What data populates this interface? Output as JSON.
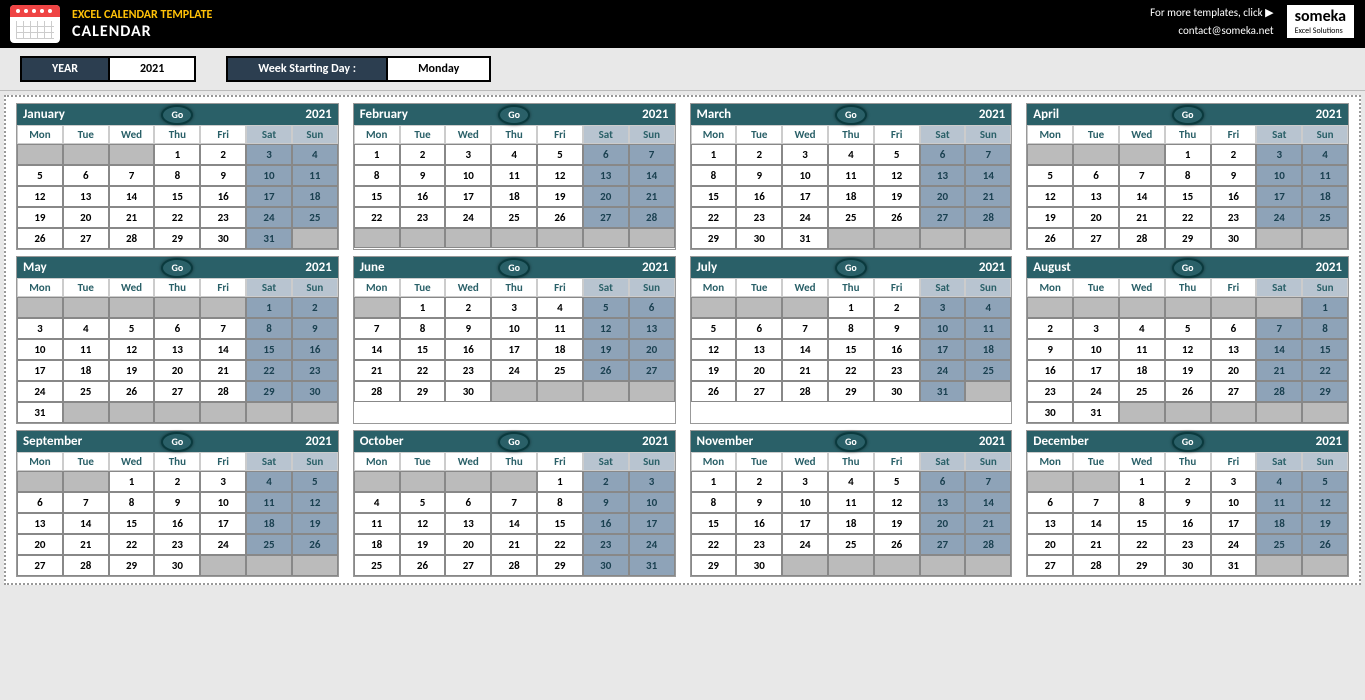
{
  "header": {
    "title_small": "EXCEL CALENDAR TEMPLATE",
    "title_large": "CALENDAR",
    "more_templates": "For more templates, click ▶",
    "contact": "contact@someka.net",
    "logo_name": "someka",
    "logo_subtitle": "Excel Solutions"
  },
  "controls": {
    "year_label": "YEAR",
    "year_value": "2021",
    "week_start_label": "Week Starting Day :",
    "week_start_value": "Monday"
  },
  "go_label": "Go",
  "day_names": [
    "Mon",
    "Tue",
    "Wed",
    "Thu",
    "Fri",
    "Sat",
    "Sun"
  ],
  "year_display": "2021",
  "months": [
    {
      "name": "January",
      "offset": 3,
      "days": 31
    },
    {
      "name": "February",
      "offset": 0,
      "days": 28
    },
    {
      "name": "March",
      "offset": 0,
      "days": 31
    },
    {
      "name": "April",
      "offset": 3,
      "days": 30
    },
    {
      "name": "May",
      "offset": 5,
      "days": 31
    },
    {
      "name": "June",
      "offset": 1,
      "days": 30
    },
    {
      "name": "July",
      "offset": 3,
      "days": 31
    },
    {
      "name": "August",
      "offset": 6,
      "days": 31
    },
    {
      "name": "September",
      "offset": 2,
      "days": 30
    },
    {
      "name": "October",
      "offset": 4,
      "days": 31
    },
    {
      "name": "November",
      "offset": 0,
      "days": 30
    },
    {
      "name": "December",
      "offset": 2,
      "days": 31
    }
  ]
}
